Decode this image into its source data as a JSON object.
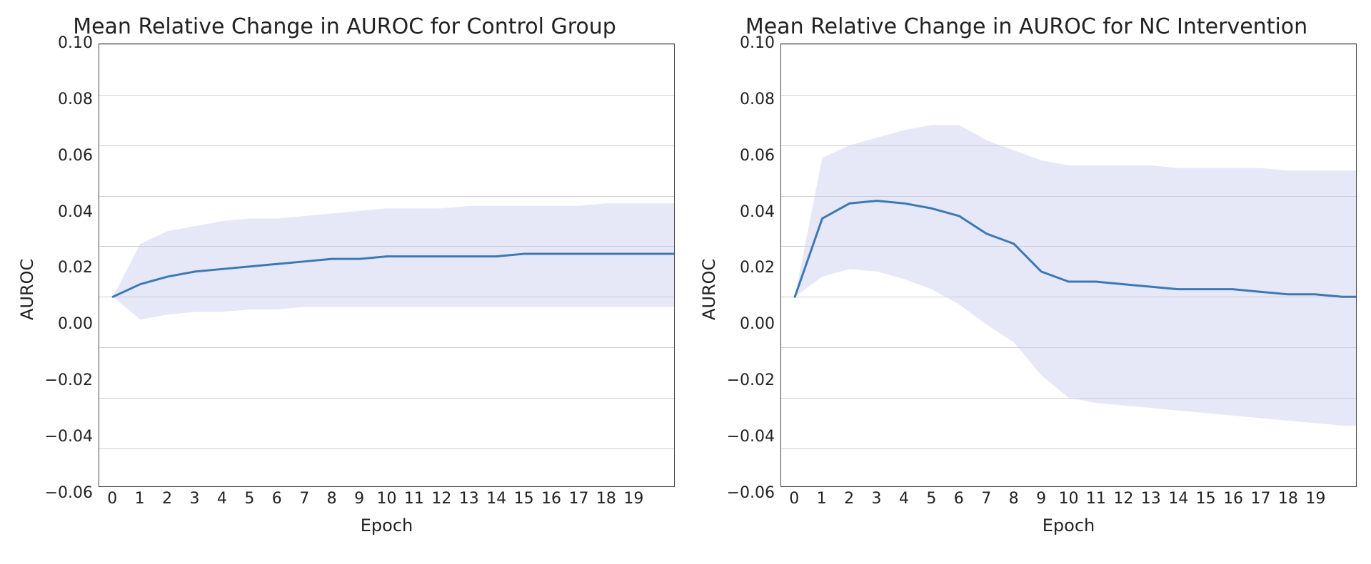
{
  "axes": {
    "ylabel": "AUROC",
    "xlabel": "Epoch",
    "ylim": [
      -0.075,
      0.1
    ],
    "xlim": [
      -0.5,
      20.5
    ],
    "yticks": [
      -0.06,
      -0.04,
      -0.02,
      0.0,
      0.02,
      0.04,
      0.06,
      0.08,
      0.1
    ],
    "ytick_labels": [
      "−0.06",
      "−0.04",
      "−0.02",
      "0.00",
      "0.02",
      "0.04",
      "0.06",
      "0.08",
      "0.10"
    ],
    "xticks": [
      0,
      1,
      2,
      3,
      4,
      5,
      6,
      7,
      8,
      9,
      10,
      11,
      12,
      13,
      14,
      15,
      16,
      17,
      18,
      19
    ],
    "xtick_labels": [
      "0",
      "1",
      "2",
      "3",
      "4",
      "5",
      "6",
      "7",
      "8",
      "9",
      "10",
      "11",
      "12",
      "13",
      "14",
      "15",
      "16",
      "17",
      "18",
      "19"
    ]
  },
  "panels": [
    {
      "id": "control",
      "title": "Mean Relative Change in AUROC for Control Group"
    },
    {
      "id": "nc",
      "title": "Mean Relative Change in AUROC for NC Intervention"
    }
  ],
  "colors": {
    "line": "#3c78b4",
    "band": "#c7cdf0",
    "grid": "#cfcfcf",
    "border": "#444444"
  },
  "chart_data": [
    {
      "type": "line",
      "title": "Mean Relative Change in AUROC for Control Group",
      "xlabel": "Epoch",
      "ylabel": "AUROC",
      "ylim": [
        -0.075,
        0.1
      ],
      "x": [
        0,
        1,
        2,
        3,
        4,
        5,
        6,
        7,
        8,
        9,
        10,
        11,
        12,
        13,
        14,
        15,
        16,
        17,
        18,
        19,
        20
      ],
      "series": [
        {
          "name": "mean",
          "values": [
            0.0,
            0.005,
            0.008,
            0.01,
            0.011,
            0.012,
            0.013,
            0.014,
            0.015,
            0.015,
            0.016,
            0.016,
            0.016,
            0.016,
            0.016,
            0.017,
            0.017,
            0.017,
            0.017,
            0.017,
            0.017
          ]
        },
        {
          "name": "upper",
          "values": [
            0.0,
            0.021,
            0.026,
            0.028,
            0.03,
            0.031,
            0.031,
            0.032,
            0.033,
            0.034,
            0.035,
            0.035,
            0.035,
            0.036,
            0.036,
            0.036,
            0.036,
            0.036,
            0.037,
            0.037,
            0.037
          ]
        },
        {
          "name": "lower",
          "values": [
            0.0,
            -0.009,
            -0.007,
            -0.006,
            -0.006,
            -0.005,
            -0.005,
            -0.004,
            -0.004,
            -0.004,
            -0.004,
            -0.004,
            -0.004,
            -0.004,
            -0.004,
            -0.004,
            -0.004,
            -0.004,
            -0.004,
            -0.004,
            -0.004
          ]
        }
      ]
    },
    {
      "type": "line",
      "title": "Mean Relative Change in AUROC for NC Intervention",
      "xlabel": "Epoch",
      "ylabel": "AUROC",
      "ylim": [
        -0.075,
        0.1
      ],
      "x": [
        0,
        1,
        2,
        3,
        4,
        5,
        6,
        7,
        8,
        9,
        10,
        11,
        12,
        13,
        14,
        15,
        16,
        17,
        18,
        19,
        20
      ],
      "series": [
        {
          "name": "mean",
          "values": [
            0.0,
            0.031,
            0.037,
            0.038,
            0.037,
            0.035,
            0.032,
            0.025,
            0.021,
            0.01,
            0.006,
            0.006,
            0.005,
            0.004,
            0.003,
            0.003,
            0.003,
            0.002,
            0.001,
            0.001,
            0.0
          ]
        },
        {
          "name": "upper",
          "values": [
            0.0,
            0.055,
            0.06,
            0.063,
            0.066,
            0.068,
            0.068,
            0.062,
            0.058,
            0.054,
            0.052,
            0.052,
            0.052,
            0.052,
            0.051,
            0.051,
            0.051,
            0.051,
            0.05,
            0.05,
            0.05
          ]
        },
        {
          "name": "lower",
          "values": [
            0.0,
            0.008,
            0.011,
            0.01,
            0.007,
            0.003,
            -0.003,
            -0.011,
            -0.018,
            -0.031,
            -0.04,
            -0.042,
            -0.043,
            -0.044,
            -0.045,
            -0.046,
            -0.047,
            -0.048,
            -0.049,
            -0.05,
            -0.051
          ]
        }
      ]
    }
  ]
}
